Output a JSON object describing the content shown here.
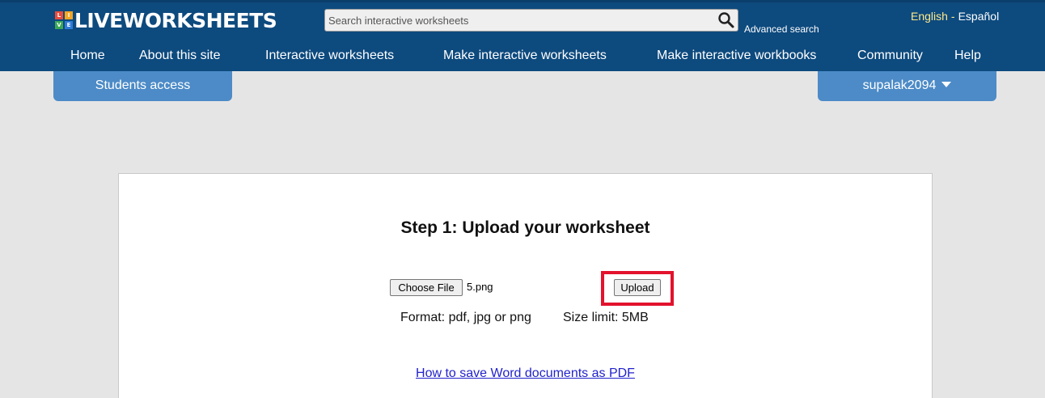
{
  "header": {
    "logo_text": "LIVEWORKSHEETS",
    "logo_letters": [
      "L",
      "I",
      "V",
      "E"
    ],
    "search_placeholder": "Search interactive worksheets",
    "advanced_search": "Advanced search",
    "lang_english": "English",
    "lang_separator": "-",
    "lang_spanish": "Español"
  },
  "nav": {
    "items": [
      "Home",
      "About this site",
      "Interactive worksheets",
      "Make interactive worksheets",
      "Make interactive workbooks",
      "Community",
      "Help"
    ]
  },
  "tabs": {
    "students": "Students access",
    "user": "supalak2094"
  },
  "upload": {
    "title": "Step 1: Upload your worksheet",
    "choose_file": "Choose File",
    "file_name": "5.png",
    "upload_button": "Upload",
    "format": "Format: pdf, jpg or png",
    "size_limit": "Size limit: 5MB",
    "howto_link": "How to save Word documents as PDF"
  },
  "colors": {
    "header_bg": "#0d4a7e",
    "tab_bg": "#4c8bc7",
    "highlight": "#e3122d",
    "page_bg": "#e6e5e6"
  }
}
